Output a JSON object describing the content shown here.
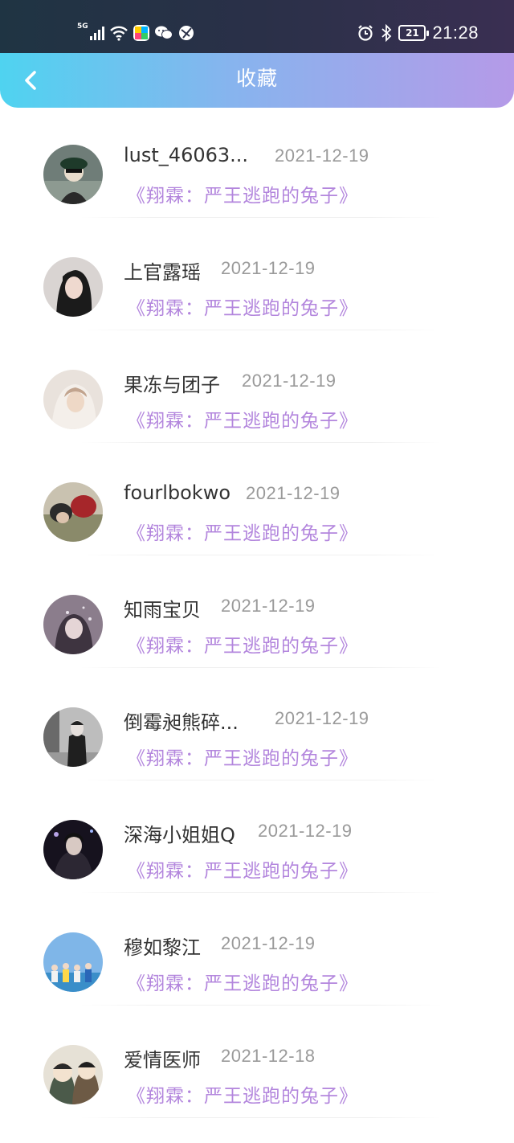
{
  "status_bar": {
    "network": "5G",
    "battery": "21",
    "time": "21:28"
  },
  "header": {
    "title": "收藏",
    "back_icon": "chevron-left-icon"
  },
  "items": [
    {
      "name": "lust_46063...",
      "date": "2021-12-19",
      "book": "《翔霖：严王逃跑的兔子》"
    },
    {
      "name": "上官露瑶",
      "date": "2021-12-19",
      "book": "《翔霖：严王逃跑的兔子》"
    },
    {
      "name": "果冻与团子",
      "date": "2021-12-19",
      "book": "《翔霖：严王逃跑的兔子》"
    },
    {
      "name": "fourlbokwo",
      "date": "2021-12-19",
      "book": "《翔霖：严王逃跑的兔子》"
    },
    {
      "name": "知雨宝贝",
      "date": "2021-12-19",
      "book": "《翔霖：严王逃跑的兔子》"
    },
    {
      "name": "倒霉昶熊碎...",
      "date": "2021-12-19",
      "book": "《翔霖：严王逃跑的兔子》"
    },
    {
      "name": "深海小姐姐Q",
      "date": "2021-12-19",
      "book": "《翔霖：严王逃跑的兔子》"
    },
    {
      "name": "穆如黎江",
      "date": "2021-12-19",
      "book": "《翔霖：严王逃跑的兔子》"
    },
    {
      "name": "爱情医师",
      "date": "2021-12-18",
      "book": "《翔霖：严王逃跑的兔子》"
    }
  ],
  "colors": {
    "book_title": "#b386dd",
    "header_start": "#4fd3f0",
    "header_end": "#b59ae8"
  }
}
